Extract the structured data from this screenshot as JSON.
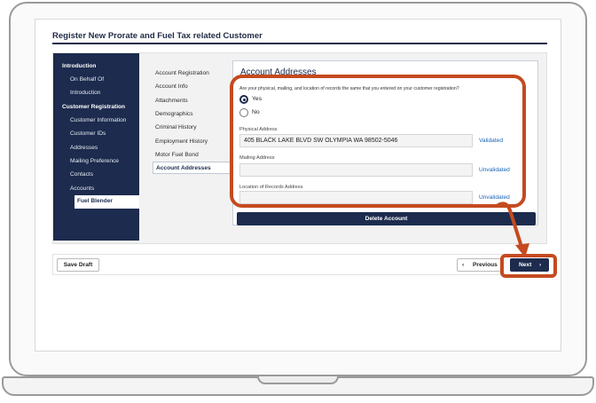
{
  "page": {
    "title": "Register New Prorate and Fuel Tax related Customer"
  },
  "sidebar": {
    "items": [
      {
        "label": "Introduction",
        "type": "heading"
      },
      {
        "label": "On Behalf Of",
        "type": "item"
      },
      {
        "label": "Introduction",
        "type": "item"
      },
      {
        "label": "Customer Registration",
        "type": "heading"
      },
      {
        "label": "Customer Information",
        "type": "item"
      },
      {
        "label": "Customer IDs",
        "type": "item"
      },
      {
        "label": "Addresses",
        "type": "item"
      },
      {
        "label": "Mailing Preference",
        "type": "item"
      },
      {
        "label": "Contacts",
        "type": "item"
      },
      {
        "label": "Accounts",
        "type": "item"
      }
    ],
    "active_sub": "Fuel Blender"
  },
  "subnav": {
    "items": [
      "Account Registration",
      "Account Info",
      "Attachments",
      "Demographics",
      "Criminal History",
      "Employment History",
      "Motor Fuel Bond"
    ],
    "active": "Account Addresses"
  },
  "content": {
    "title": "Account Addresses",
    "question": "Are your physical, mailing, and location of records the same that you entered on your customer registration?",
    "options": [
      {
        "label": "Yes",
        "checked": true
      },
      {
        "label": "No",
        "checked": false
      }
    ],
    "fields": [
      {
        "label": "Physical Address",
        "value": "405 BLACK LAKE BLVD SW OLYMPIA WA 98502-5046",
        "status": "Validated"
      },
      {
        "label": "Mailing Address",
        "value": "",
        "status": "Unvalidated"
      },
      {
        "label": "Location of Records Address",
        "value": "",
        "status": "Unvalidated"
      }
    ],
    "delete_label": "Delete Account"
  },
  "footer": {
    "save_draft": "Save Draft",
    "previous": "Previous",
    "next": "Next"
  },
  "colors": {
    "navy": "#1c2b4e",
    "annotation": "#c54a1f",
    "link": "#1a64b8"
  },
  "icons": {
    "previous": "chevron-left-icon",
    "next": "chevron-right-icon"
  }
}
